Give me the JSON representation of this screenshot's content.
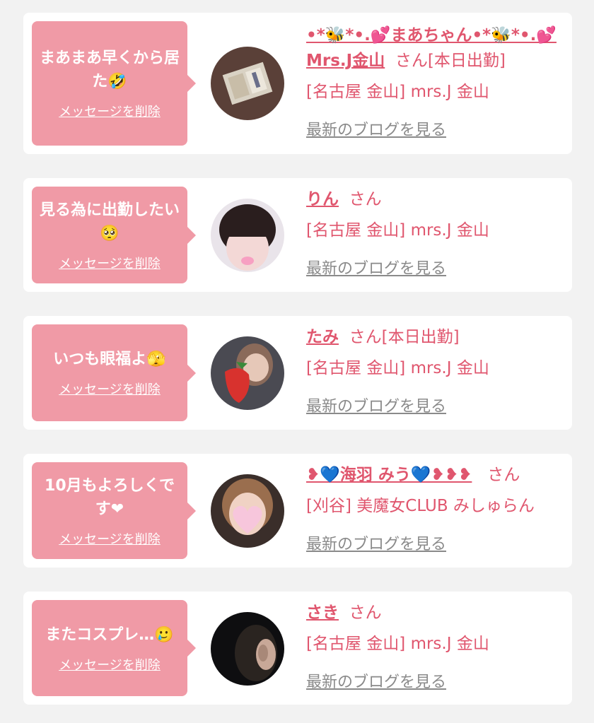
{
  "items": [
    {
      "message": "まあまあ早くから居た🤣",
      "delete_label": "メッセージを削除",
      "name": "•*🐝*•.💕まあちゃん•*🐝*•.💕Mrs.J金山",
      "san": "さん[本日出勤]",
      "shop": "[名古屋 金山] mrs.J 金山",
      "blog_label": "最新のブログを見る"
    },
    {
      "message": "見る為に出勤したい🥺",
      "delete_label": "メッセージを削除",
      "name": "りん",
      "san": "さん",
      "shop": "[名古屋 金山] mrs.J 金山",
      "blog_label": "最新のブログを見る"
    },
    {
      "message": "いつも眼福よ🫣",
      "delete_label": "メッセージを削除",
      "name": "たみ",
      "san": "さん[本日出勤]",
      "shop": "[名古屋 金山] mrs.J 金山",
      "blog_label": "最新のブログを見る"
    },
    {
      "message": "10月もよろしくです❤",
      "delete_label": "メッセージを削除",
      "name": "❥💙海羽 みう💙❥❥❥",
      "san": "さん",
      "shop": "[刈谷] 美魔女CLUB みしゅらん",
      "blog_label": "最新のブログを見る"
    },
    {
      "message": "またコスプレ…🥲",
      "delete_label": "メッセージを削除",
      "name": "さき",
      "san": "さん",
      "shop": "[名古屋 金山] mrs.J 金山",
      "blog_label": "最新のブログを見る"
    }
  ]
}
